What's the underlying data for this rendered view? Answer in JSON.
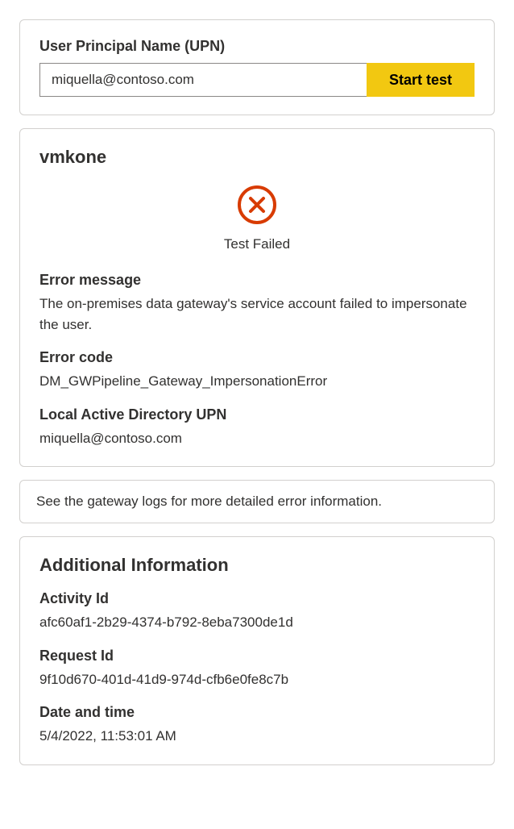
{
  "upn": {
    "label": "User Principal Name (UPN)",
    "value": "miquella@contoso.com",
    "button": "Start test"
  },
  "result": {
    "gateway_name": "vmkone",
    "status_text": "Test Failed",
    "error_message_label": "Error message",
    "error_message": "The on-premises data gateway's service account failed to impersonate the user.",
    "error_code_label": "Error code",
    "error_code": "DM_GWPipeline_Gateway_ImpersonationError",
    "local_upn_label": "Local Active Directory UPN",
    "local_upn": "miquella@contoso.com"
  },
  "hint": {
    "text": "See the gateway logs for more detailed error information."
  },
  "additional": {
    "title": "Additional Information",
    "activity_id_label": "Activity Id",
    "activity_id": "afc60af1-2b29-4374-b792-8eba7300de1d",
    "request_id_label": "Request Id",
    "request_id": "9f10d670-401d-41d9-974d-cfb6e0fe8c7b",
    "datetime_label": "Date and time",
    "datetime": "5/4/2022, 11:53:01 AM"
  }
}
